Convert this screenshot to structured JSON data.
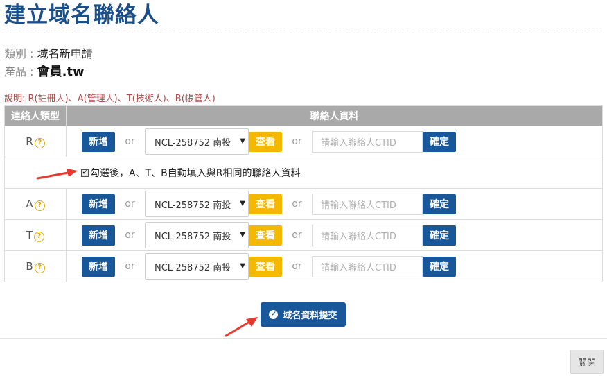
{
  "title": "建立域名聯絡人",
  "category": {
    "label": "類別 : ",
    "value": "域名新申請"
  },
  "product": {
    "label": "產品 : ",
    "value": "會員.tw"
  },
  "note": "說明: R(註冊人)、A(管理人)、T(技術人)、B(帳管人)",
  "table": {
    "headers": [
      "連絡人類型",
      "聯絡人資料"
    ],
    "new_label": "新增",
    "or_label": "or",
    "view_label": "查看",
    "ok_label": "確定",
    "ctid_placeholder": "請輸入聯絡人CTID",
    "rows": [
      {
        "type": "R",
        "selected": "NCL-258752 南投"
      },
      {
        "type": "A",
        "selected": "NCL-258752 南投"
      },
      {
        "type": "T",
        "selected": "NCL-258752 南投"
      },
      {
        "type": "B",
        "selected": "NCL-258752 南投"
      }
    ],
    "autofill_label": "勾選後，A、T、B自動填入與R相同的聯絡人資料",
    "autofill_checked": true
  },
  "submit_label": "域名資料提交",
  "close_label": "關閉",
  "colors": {
    "primary": "#17579a",
    "warning": "#f5b800",
    "header_bg": "#a9a9a9",
    "note": "#b34a4a",
    "arrow": "#e8392e"
  }
}
